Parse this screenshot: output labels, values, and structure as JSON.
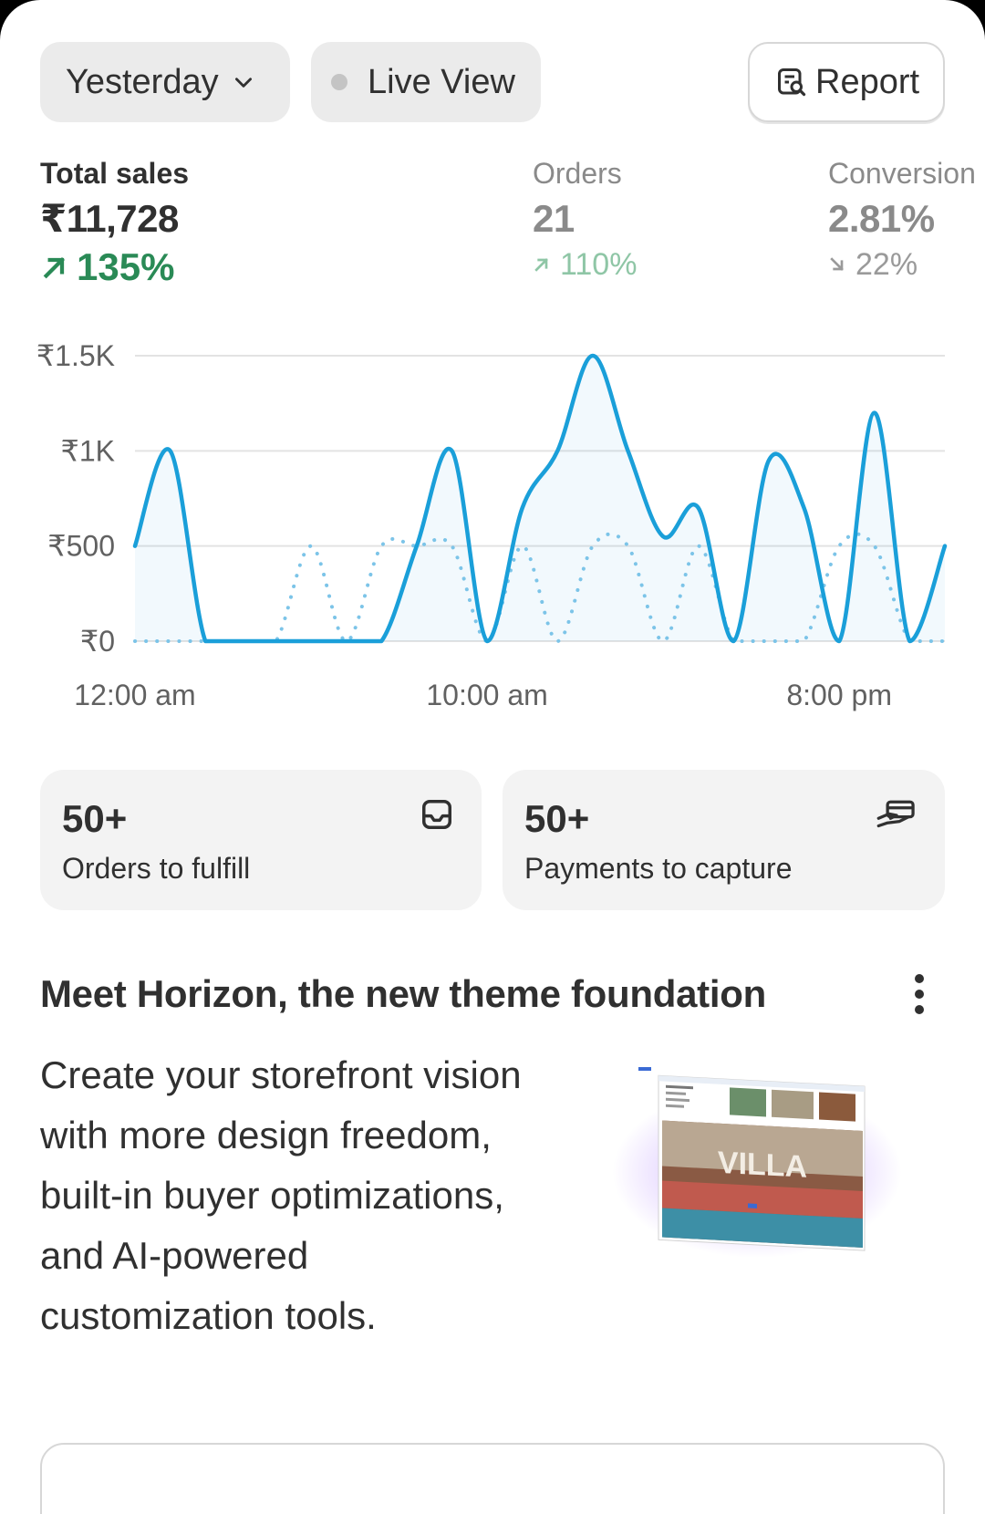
{
  "filters": {
    "period_label": "Yesterday",
    "live_view_label": "Live View",
    "report_label": "Report"
  },
  "metrics": [
    {
      "label": "Total sales",
      "value": "₹11,728",
      "delta": "135%",
      "direction": "up"
    },
    {
      "label": "Orders",
      "value": "21",
      "delta": "110%",
      "direction": "up"
    },
    {
      "label": "Conversion",
      "value": "2.81%",
      "delta": "22%",
      "direction": "down"
    }
  ],
  "chart_data": {
    "type": "line",
    "ylim": [
      0,
      1500
    ],
    "ytick_labels": [
      "₹0",
      "₹500",
      "₹1K",
      "₹1.5K"
    ],
    "yticks": [
      0,
      500,
      1000,
      1500
    ],
    "xtick_labels": [
      "12:00 am",
      "10:00 am",
      "8:00 pm"
    ],
    "xtick_hours": [
      0,
      10,
      20
    ],
    "x_hours": [
      0,
      1,
      2,
      3,
      4,
      5,
      6,
      7,
      8,
      9,
      10,
      11,
      12,
      13,
      14,
      15,
      16,
      17,
      18,
      19,
      20,
      21,
      22,
      23
    ],
    "series": [
      {
        "style": "solid",
        "color": "#1a9fd9",
        "values": [
          500,
          1000,
          0,
          0,
          0,
          0,
          0,
          0,
          500,
          1000,
          0,
          700,
          1000,
          1500,
          1000,
          550,
          700,
          0,
          950,
          700,
          0,
          1200,
          0,
          500
        ]
      },
      {
        "style": "dotted",
        "color": "#7cc4e8",
        "values": [
          0,
          0,
          0,
          0,
          0,
          500,
          0,
          500,
          500,
          500,
          0,
          500,
          0,
          500,
          500,
          0,
          500,
          0,
          0,
          0,
          500,
          500,
          0,
          0
        ]
      }
    ],
    "grid": true
  },
  "cards": [
    {
      "count": "50+",
      "label": "Orders to fulfill",
      "icon": "inbox-icon"
    },
    {
      "count": "50+",
      "label": "Payments to capture",
      "icon": "payment-hand-icon"
    }
  ],
  "promo": {
    "title": "Meet Horizon, the new theme foundation",
    "body": "Create your storefront vision with more design freedom, built-in buyer optimizations, and AI-powered customization tools.",
    "image_text": "VILLA"
  },
  "colors": {
    "accent_line": "#1a9fd9",
    "positive": "#2a8a56",
    "muted": "#8a8a8a"
  }
}
